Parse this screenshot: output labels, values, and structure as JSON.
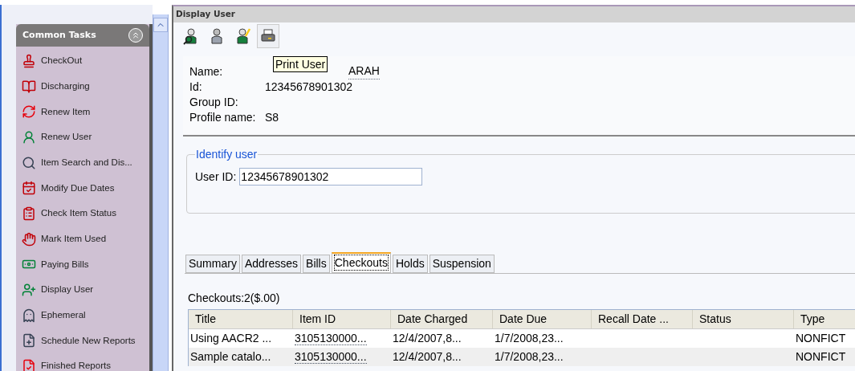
{
  "sidebar": {
    "title": "Common Tasks",
    "items": [
      {
        "label": "CheckOut"
      },
      {
        "label": "Discharging"
      },
      {
        "label": "Renew Item"
      },
      {
        "label": "Renew User"
      },
      {
        "label": "Item Search and Dis..."
      },
      {
        "label": "Modify Due Dates"
      },
      {
        "label": "Check Item Status"
      },
      {
        "label": "Mark Item Used"
      },
      {
        "label": "Paying Bills"
      },
      {
        "label": "Display User"
      },
      {
        "label": "Ephemeral"
      },
      {
        "label": "Schedule New Reports"
      },
      {
        "label": "Finished Reports"
      }
    ]
  },
  "window": {
    "title": "Display User"
  },
  "toolbar": {
    "buttons": [
      {
        "disabled": false,
        "hovered": false
      },
      {
        "disabled": true,
        "hovered": false
      },
      {
        "disabled": false,
        "hovered": false
      },
      {
        "disabled": false,
        "hovered": true
      }
    ],
    "tooltip": "Print User"
  },
  "user_info": [
    {
      "label": "Name:",
      "value": "ARAH"
    },
    {
      "label": "Id:",
      "value": "12345678901302"
    },
    {
      "label": "Group ID:"
    },
    {
      "label": "Profile name:",
      "value": "S8"
    }
  ],
  "identify": {
    "legend": "Identify user",
    "label": "User ID:",
    "value": "12345678901302"
  },
  "tabs": [
    {
      "label": "Summary",
      "selected": false
    },
    {
      "label": "Addresses",
      "selected": false
    },
    {
      "label": "Bills",
      "selected": false
    },
    {
      "label": "Checkouts",
      "selected": true
    },
    {
      "label": "Holds",
      "selected": false
    },
    {
      "label": "Suspension",
      "selected": false
    }
  ],
  "checkouts": {
    "summary": "Checkouts:2($.00)",
    "columns": [
      "Title",
      "Item ID",
      "Date Charged",
      "Date Due",
      "Recall Date ...",
      "Status",
      "Type"
    ],
    "rows": [
      [
        "Using AACR2 ...",
        "3105130000...",
        "12/4/2007,8...",
        "1/7/2008,23...",
        "",
        "",
        "NONFICT"
      ],
      [
        "Sample catalo...",
        "3105130000...",
        "12/4/2007,8...",
        "1/7/2008,23...",
        "",
        "",
        "NONFICT"
      ]
    ]
  }
}
